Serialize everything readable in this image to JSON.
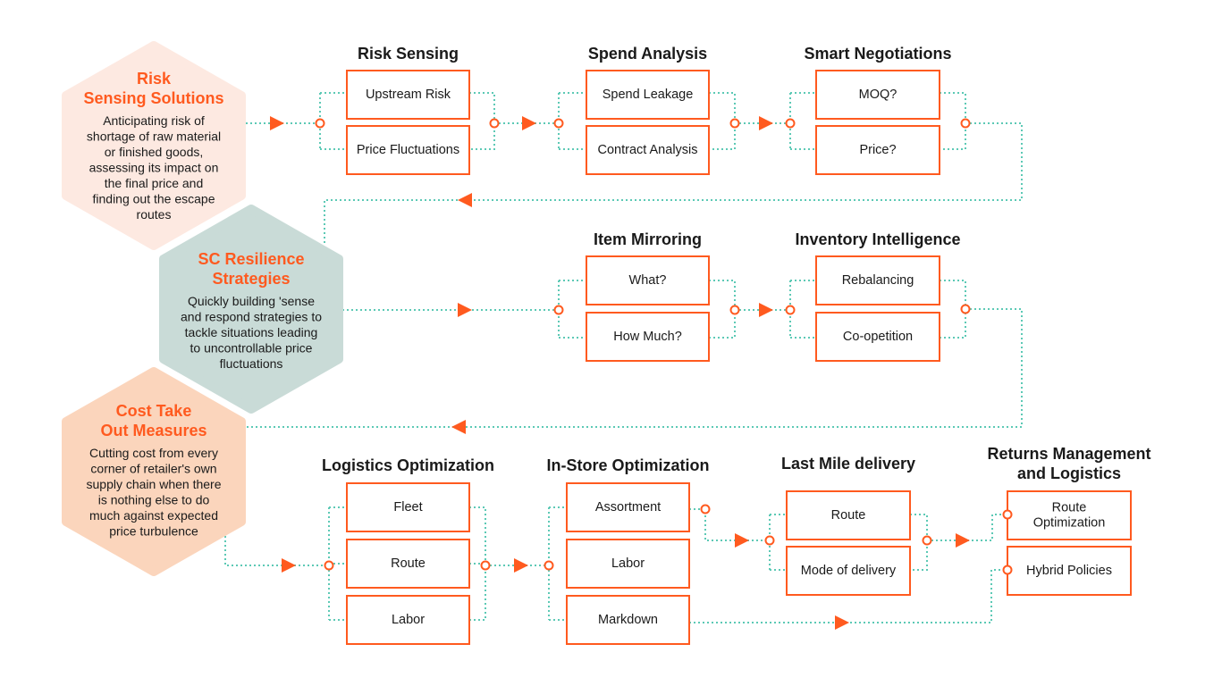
{
  "colors": {
    "accent": "#FF5A1F",
    "connector": "#5CC9B5",
    "hex1": "#FDE9E1",
    "hex2": "#C9DBD7",
    "hex3": "#FBD5BC"
  },
  "hexagons": [
    {
      "title": [
        "Risk",
        "Sensing Solutions"
      ],
      "text": [
        "Anticipating risk of",
        "shortage of raw material",
        "or finished goods,",
        "assessing its impact on",
        "the final price and",
        "finding out the escape",
        "routes"
      ]
    },
    {
      "title": [
        "SC Resilience",
        "Strategies"
      ],
      "text": [
        "Quickly building 'sense",
        "and respond strategies to",
        "tackle situations leading",
        "to uncontrollable price",
        "fluctuations"
      ]
    },
    {
      "title": [
        "Cost Take",
        "Out Measures"
      ],
      "text": [
        "Cutting cost from every",
        "corner of retailer's own",
        "supply chain when there",
        "is nothing else to do",
        "much against expected",
        "price turbulence"
      ]
    }
  ],
  "groups": [
    {
      "title": [
        "Risk Sensing"
      ],
      "items": [
        "Upstream Risk",
        "Price Fluctuations"
      ]
    },
    {
      "title": [
        "Spend Analysis"
      ],
      "items": [
        "Spend Leakage",
        "Contract Analysis"
      ]
    },
    {
      "title": [
        "Smart Negotiations"
      ],
      "items": [
        "MOQ?",
        "Price?"
      ]
    },
    {
      "title": [
        "Item Mirroring"
      ],
      "items": [
        "What?",
        "How Much?"
      ]
    },
    {
      "title": [
        "Inventory Intelligence"
      ],
      "items": [
        "Rebalancing",
        "Co-opetition"
      ]
    },
    {
      "title": [
        "Logistics Optimization"
      ],
      "items": [
        "Fleet",
        "Route",
        "Labor"
      ]
    },
    {
      "title": [
        "In-Store Optimization"
      ],
      "items": [
        "Assortment",
        "Labor",
        "Markdown"
      ]
    },
    {
      "title": [
        "Last Mile delivery"
      ],
      "items": [
        "Route",
        "Mode of delivery"
      ]
    },
    {
      "title": [
        "Returns Management",
        "and Logistics"
      ],
      "items": [
        [
          "Route",
          "Optimization"
        ],
        "Hybrid Policies"
      ]
    }
  ]
}
